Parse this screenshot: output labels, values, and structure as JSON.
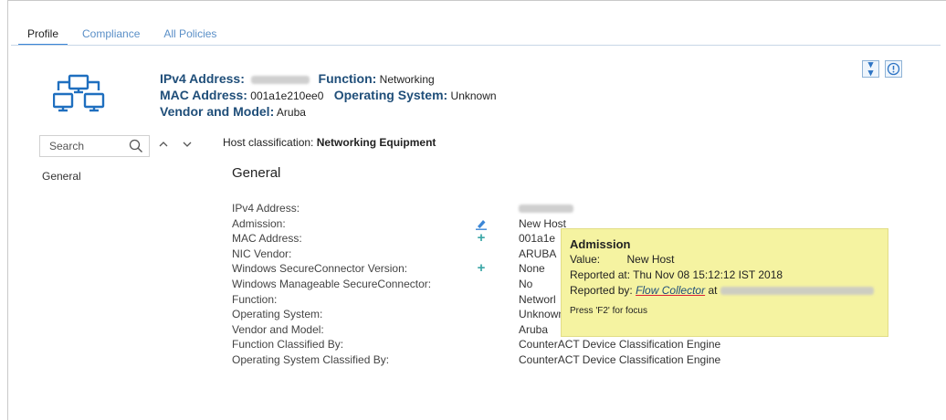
{
  "tabs": [
    {
      "label": "Profile",
      "active": true
    },
    {
      "label": "Compliance",
      "active": false
    },
    {
      "label": "All Policies",
      "active": false
    }
  ],
  "header": {
    "ipv4_label": "IPv4 Address:",
    "function_label": "Function:",
    "function_value": "Networking",
    "mac_label": "MAC Address:",
    "mac_value": "001a1e210ee0",
    "os_label": "Operating System:",
    "os_value": "Unknown",
    "vendor_label": "Vendor and Model:",
    "vendor_value": "Aruba",
    "icon": "network-devices-icon"
  },
  "toolbar": {
    "collapse_icon": "double-chevron-down-icon",
    "info_icon": "info-circle-icon"
  },
  "sidebar": {
    "search_placeholder": "Search",
    "items": [
      {
        "label": "General"
      }
    ]
  },
  "classification": {
    "label": "Host classification:",
    "value": "Networking Equipment"
  },
  "section": {
    "title": "General"
  },
  "properties": [
    {
      "key": "IPv4 Address:",
      "value": "",
      "action": ""
    },
    {
      "key": "Admission:",
      "value": "New Host",
      "action": "edit"
    },
    {
      "key": "MAC Address:",
      "value": "001a1e",
      "action": "add"
    },
    {
      "key": "NIC Vendor:",
      "value": "ARUBA",
      "action": ""
    },
    {
      "key": "Windows SecureConnector Version:",
      "value": "None",
      "action": "add"
    },
    {
      "key": "Windows Manageable SecureConnector:",
      "value": "No",
      "action": ""
    },
    {
      "key": "Function:",
      "value": "Networl",
      "action": ""
    },
    {
      "key": "Operating System:",
      "value": "Unknown",
      "action": ""
    },
    {
      "key": "Vendor and Model:",
      "value": "Aruba",
      "action": ""
    },
    {
      "key": "Function Classified By:",
      "value": "CounterACT Device Classification Engine",
      "action": ""
    },
    {
      "key": "Operating System Classified By:",
      "value": "CounterACT Device Classification Engine",
      "action": ""
    }
  ],
  "tooltip": {
    "title": "Admission",
    "value_label": "Value:",
    "value": "New Host",
    "reported_at_label": "Reported at:",
    "reported_at": "Thu Nov 08 15:12:12 IST 2018",
    "reported_by_label": "Reported by:",
    "reported_by": "Flow Collector",
    "at_word": "at",
    "hint": "Press 'F2' for focus"
  },
  "colors": {
    "accent": "#3b86d6",
    "tooltip_bg": "#f5f3a1",
    "header_label": "#1f4e79"
  }
}
